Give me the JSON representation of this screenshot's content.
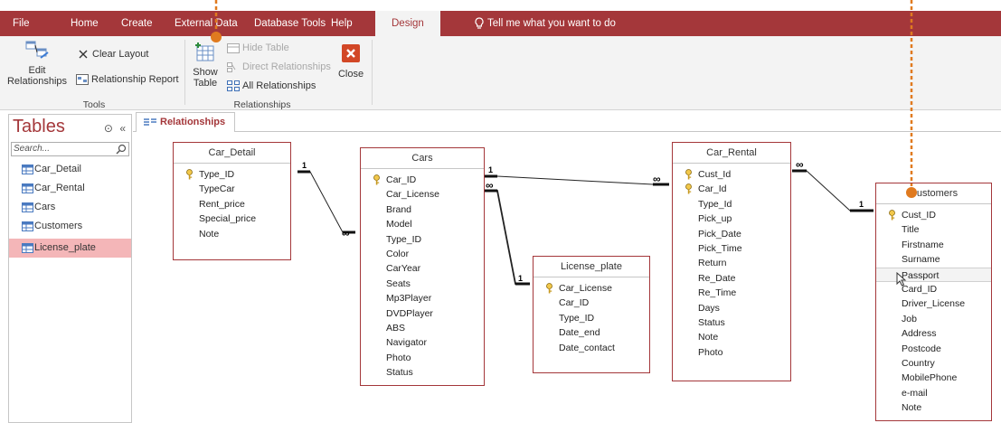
{
  "ribbon": {
    "tabs": [
      {
        "label": "File"
      },
      {
        "label": "Home"
      },
      {
        "label": "Create"
      },
      {
        "label": "External Data"
      },
      {
        "label": "Database Tools"
      },
      {
        "label": "Help"
      },
      {
        "label": "Design"
      }
    ],
    "active_tab": "Design",
    "tell_me": "Tell me what you want to do",
    "tools_group": {
      "label": "Tools",
      "edit_relationships": "Edit Relationships",
      "edit_line1": "Edit",
      "edit_line2": "Relationships",
      "clear_layout": "Clear Layout",
      "relationship_report": "Relationship Report"
    },
    "relationships_group": {
      "label": "Relationships",
      "show_table_line1": "Show",
      "show_table_line2": "Table",
      "hide_table": "Hide Table",
      "direct_relationships": "Direct Relationships",
      "all_relationships": "All Relationships",
      "close": "Close"
    }
  },
  "nav": {
    "title": "Tables",
    "search_placeholder": "Search...",
    "items": [
      {
        "label": "Car_Detail"
      },
      {
        "label": "Car_Rental"
      },
      {
        "label": "Cars"
      },
      {
        "label": "Customers"
      },
      {
        "label": "License_plate"
      }
    ],
    "selected": "License_plate"
  },
  "document_tab": {
    "label": "Relationships"
  },
  "tables": {
    "car_detail": {
      "title": "Car_Detail",
      "fields": [
        "Type_ID",
        "TypeCar",
        "Rent_price",
        "Special_price",
        "Note"
      ],
      "key": "Type_ID"
    },
    "cars": {
      "title": "Cars",
      "fields": [
        "Car_ID",
        "Car_License",
        "Brand",
        "Model",
        "Type_ID",
        "Color",
        "CarYear",
        "Seats",
        "Mp3Player",
        "DVDPlayer",
        "ABS",
        "Navigator",
        "Photo",
        "Status"
      ],
      "key": "Car_ID"
    },
    "license_plate": {
      "title": "License_plate",
      "fields": [
        "Car_License",
        "Car_ID",
        "Type_ID",
        "Date_end",
        "Date_contact"
      ],
      "key": "Car_License"
    },
    "car_rental": {
      "title": "Car_Rental",
      "fields": [
        "Cust_Id",
        "Car_Id",
        "Type_Id",
        "Pick_up",
        "Pick_Date",
        "Pick_Time",
        "Return",
        "Re_Date",
        "Re_Time",
        "Days",
        "Status",
        "Note",
        "Photo"
      ],
      "keys": [
        "Cust_Id",
        "Car_Id"
      ]
    },
    "customers": {
      "title": "Customers",
      "fields": [
        "Cust_ID",
        "Title",
        "Firstname",
        "Surname",
        "Passport",
        "Card_ID",
        "Driver_License",
        "Job",
        "Address",
        "Postcode",
        "Country",
        "MobilePhone",
        "e-mail",
        "Note"
      ],
      "key": "Cust_ID",
      "hovered_field": "Passport"
    }
  },
  "relationship_labels": {
    "one": "1",
    "many": "∞"
  },
  "colors": {
    "accent": "#a4373a",
    "callout": "#e07a1f",
    "selected": "#f4b6b8"
  }
}
